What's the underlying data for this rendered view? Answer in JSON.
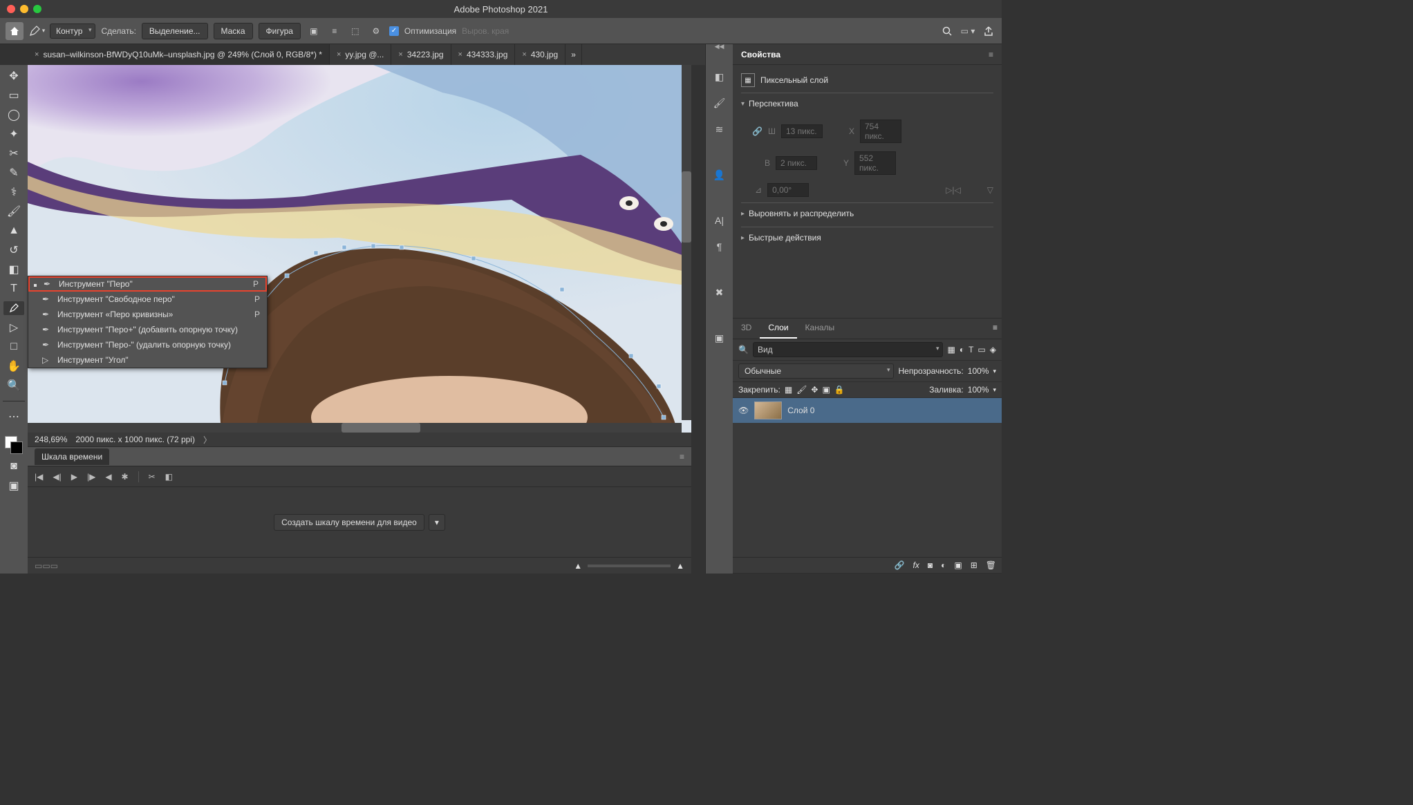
{
  "app": {
    "title": "Adobe Photoshop 2021"
  },
  "optbar": {
    "mode": "Контур",
    "make_label": "Сделать:",
    "selection": "Выделение...",
    "mask": "Маска",
    "shape": "Фигура",
    "optim_checked": true,
    "optim_label": "Оптимизация",
    "align_label": "Выров. края"
  },
  "tabs": [
    {
      "name": "susan–wilkinson-BfWDyQ10uMk–unsplash.jpg @ 249% (Слой 0, RGB/8*) *",
      "active": true
    },
    {
      "name": "yy.jpg @...",
      "active": false
    },
    {
      "name": "34223.jpg",
      "active": false
    },
    {
      "name": "434333.jpg",
      "active": false
    },
    {
      "name": "430.jpg",
      "active": false
    }
  ],
  "flyout": {
    "items": [
      {
        "label": "Инструмент \"Перо\"",
        "key": "P",
        "selected": true,
        "highlighted": true
      },
      {
        "label": "Инструмент \"Свободное перо\"",
        "key": "P"
      },
      {
        "label": "Инструмент «Перо кривизны»",
        "key": "P"
      },
      {
        "label": "Инструмент \"Перо+\" (добавить опорную точку)",
        "key": ""
      },
      {
        "label": "Инструмент \"Перо-\" (удалить опорную точку)",
        "key": ""
      },
      {
        "label": "Инструмент \"Угол\"",
        "key": ""
      }
    ]
  },
  "status": {
    "zoom": "248,69%",
    "info": "2000 пикс. x 1000 пикс. (72 ppi)"
  },
  "timeline": {
    "title": "Шкала времени",
    "create_label": "Создать шкалу времени для видео"
  },
  "properties": {
    "title": "Свойства",
    "type_label": "Пиксельный слой",
    "perspective": "Перспектива",
    "w_label": "Ш",
    "w_val": "13 пикс.",
    "h_label": "В",
    "h_val": "2 пикс.",
    "x_label": "X",
    "x_val": "754 пикс.",
    "y_label": "Y",
    "y_val": "552 пикс.",
    "angle": "0,00°",
    "align": "Выровнять и распределить",
    "quick": "Быстрые действия"
  },
  "layers": {
    "tab_3d": "3D",
    "tab_layers": "Слои",
    "tab_channels": "Каналы",
    "search_placeholder": "Вид",
    "blend": "Обычные",
    "opacity_label": "Непрозрачность:",
    "opacity": "100%",
    "lock_label": "Закрепить:",
    "fill_label": "Заливка:",
    "fill": "100%",
    "layer0": "Слой 0"
  }
}
